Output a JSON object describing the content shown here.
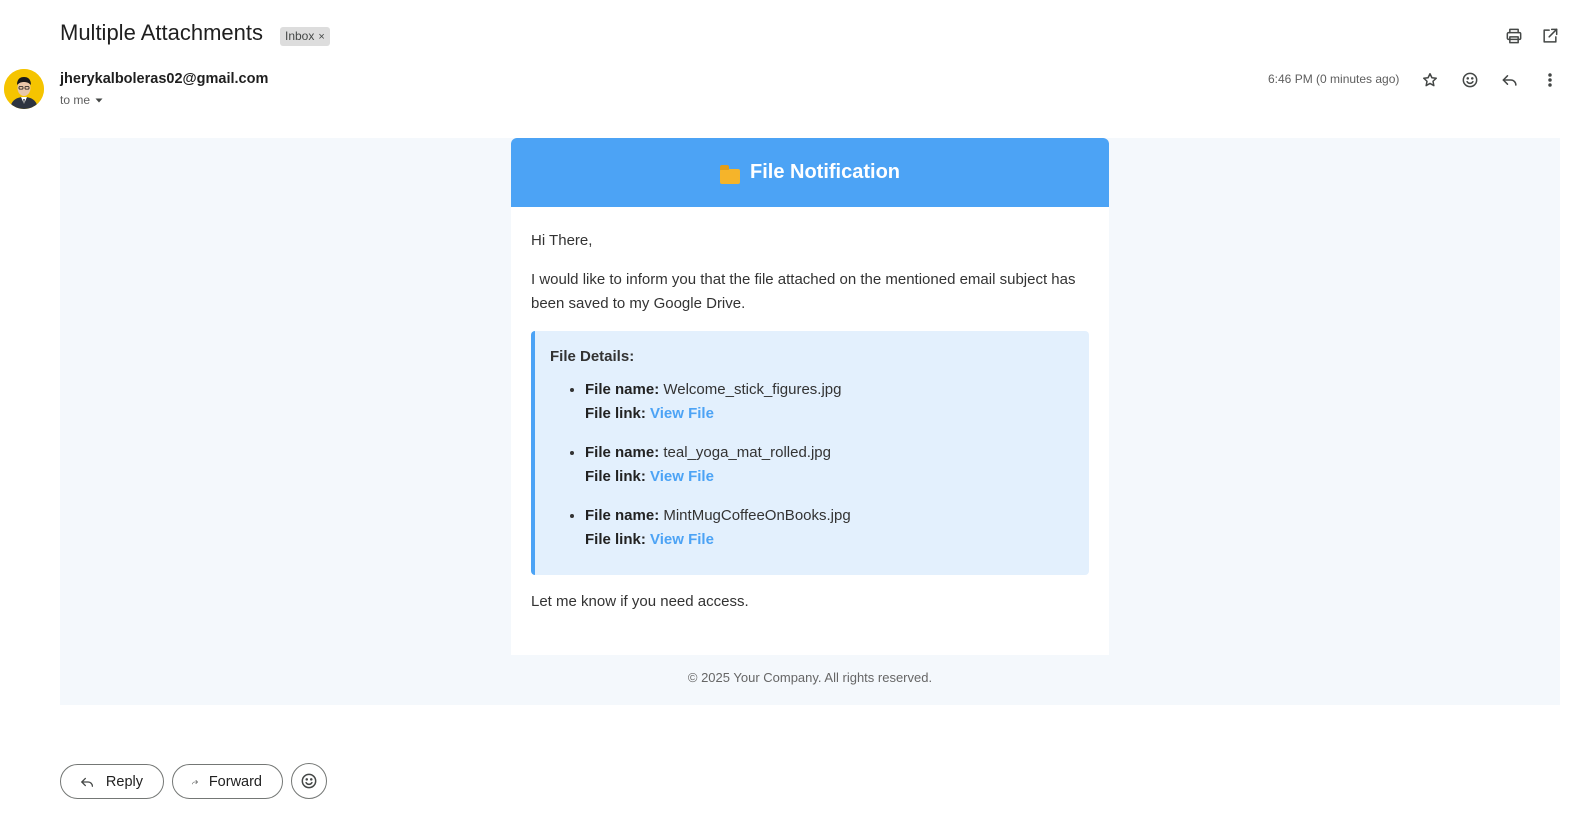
{
  "subject": "Multiple Attachments",
  "label_chip": {
    "text": "Inbox",
    "close": "×"
  },
  "top_actions": [
    {
      "name": "print-icon"
    },
    {
      "name": "open-in-new-window-icon"
    }
  ],
  "sender": {
    "email": "jherykalboleras02@gmail.com",
    "recipient": "to me",
    "time": "6:46 PM (0 minutes ago)"
  },
  "header_actions": [
    {
      "name": "star-icon"
    },
    {
      "name": "emoji-icon"
    },
    {
      "name": "reply-icon"
    },
    {
      "name": "more-vert-icon"
    }
  ],
  "email": {
    "header_title": "File Notification",
    "greeting": "Hi There,",
    "intro": "I would like to inform you that the file attached on the mentioned email subject has been saved to my Google Drive.",
    "details_title": "File Details:",
    "file_name_label": "File name:",
    "file_link_label": "File link:",
    "files": [
      {
        "name": "Welcome_stick_figures.jpg",
        "link_text": "View File"
      },
      {
        "name": "teal_yoga_mat_rolled.jpg",
        "link_text": "View File"
      },
      {
        "name": "MintMugCoffeeOnBooks.jpg",
        "link_text": "View File"
      }
    ],
    "closing": "Let me know if you need access.",
    "footer": "© 2025 Your Company. All rights reserved."
  },
  "bottom_actions": {
    "reply": "Reply",
    "forward": "Forward"
  },
  "colors": {
    "header_blue": "#4ca3f5",
    "details_bg": "#e3f0fd",
    "email_bg": "#f4f8fc",
    "avatar_bg": "#f5c400"
  }
}
